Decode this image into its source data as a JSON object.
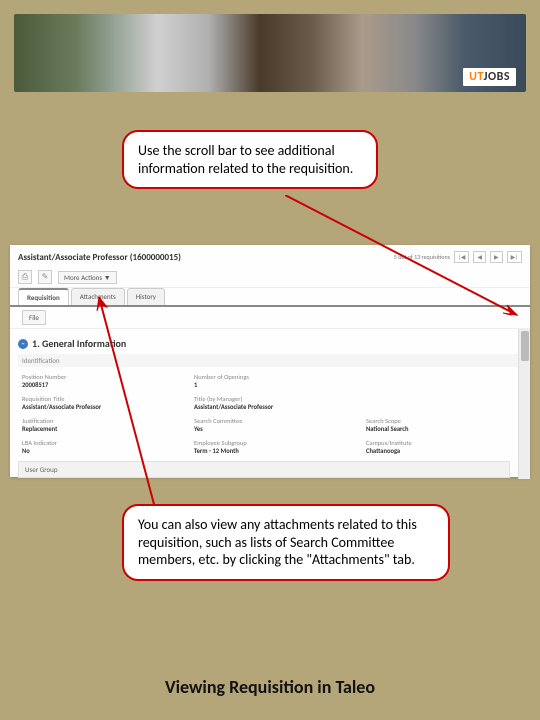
{
  "banner": {
    "logo_prefix": "UT",
    "logo_suffix": "JOBS"
  },
  "callouts": {
    "scroll": "Use the scroll bar to see additional information related to the requisition.",
    "attachments": "You can also view any attachments related to this requisition, such as lists of Search Committee members, etc. by clicking the \"Attachments\" tab."
  },
  "requisition": {
    "title": "Assistant/Associate Professor (1600000015)",
    "pager_text": "5 out of 13 requisitions",
    "pager": {
      "first": "|◀",
      "prev": "◀",
      "next": "▶",
      "last": "▶|"
    },
    "toolbar": {
      "more_actions": "More Actions ▼"
    },
    "tabs": {
      "requisition": "Requisition",
      "attachments": "Attachments",
      "history": "History"
    },
    "subtab": "File",
    "section": "1. General Information",
    "subsection": "Identification",
    "user_group": "User Group",
    "fields": {
      "position_number": {
        "label": "Position Number",
        "value": "20008517"
      },
      "openings": {
        "label": "Number of Openings",
        "value": "1"
      },
      "req_title": {
        "label": "Requisition Title",
        "value": "Assistant/Associate Professor"
      },
      "title_by": {
        "label": "Title (by Manager)",
        "value": "Assistant/Associate Professor"
      },
      "justification": {
        "label": "Justification",
        "value": "Replacement"
      },
      "search_committee": {
        "label": "Search Committee",
        "value": "Yes"
      },
      "search_scope": {
        "label": "Search Scope",
        "value": "National Search"
      },
      "lba": {
        "label": "LBA Indicator",
        "value": "No"
      },
      "subgroup": {
        "label": "Employee Subgroup",
        "value": "Term - 12 Month"
      },
      "campus": {
        "label": "Campus/Institute",
        "value": "Chattanooga"
      }
    }
  },
  "page_title": "Viewing Requisition in Taleo"
}
